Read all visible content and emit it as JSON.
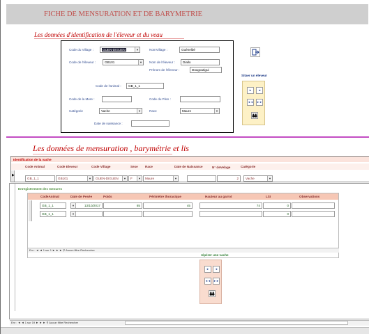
{
  "header": {
    "title": "FICHE DE MENSURATION ET DE BARYMETRIE"
  },
  "section_eleveur": {
    "heading": "Les données d'identification de l'éleveur et du veau",
    "code_village_label": "Code du Village :",
    "code_village_value": "GUEN-DIGUEN",
    "nom_village_label": "NomVillage :",
    "nom_village_value": "Guénelbé",
    "code_eleveur_label": "Code de l'éleveur :",
    "code_eleveur_value": "GB101",
    "nom_eleveur_label": "Nom de l'éleveur :",
    "nom_eleveur_value": "Diallo",
    "prenom_eleveur_label": "Prénom de l'éleveur :",
    "prenom_eleveur_value": "Dougoutigui",
    "code_animal_label": "Code de l'animal :",
    "code_animal_value": "GB_1_1",
    "code_mere_label": "Code de la Mere :",
    "code_pere_label": "Code du Père :",
    "categorie_label": "Catégorie",
    "categorie_value": "Vache",
    "race_label": "Race",
    "race_value": "Maure",
    "date_naissance_label": "Date de naissance :",
    "siter_title": "Sitaer un éleveur"
  },
  "section_mensuration": {
    "heading": "Les données de mensuration , barymétrie et lis",
    "identification_label": "Identification de la vache",
    "columns": [
      "Code Animal",
      "Code Eleveur",
      "Code Village",
      "Sexe",
      "Race",
      "Date de Naissance",
      "N° deVelage",
      "Catégorie"
    ],
    "row": {
      "code_animal": "GB_1_1",
      "code_eleveur": "GB101",
      "code_village": "GUEN-DIGUEN",
      "sexe": "F",
      "race": "Maure",
      "date_naissance": "",
      "velage": "2",
      "categorie": "Vache"
    }
  },
  "mesures": {
    "label": "Enregistrement des mesures",
    "columns": [
      "CodeAnimal",
      "Date de Pesée",
      "Poids",
      "Périmètre thoracique",
      "Hauteur au garrot",
      "LSI",
      "Observations"
    ],
    "rows": [
      {
        "code": "GB_1_1",
        "date": "13/10/2017",
        "poids": "85",
        "perimetre": "45",
        "hauteur": "74",
        "lsi": "0",
        "obs": ""
      },
      {
        "code": "GB_1_1",
        "date": "",
        "poids": "",
        "perimetre": "",
        "hauteur": "",
        "lsi": "0",
        "obs": ""
      }
    ],
    "nav_text": "Enr : ◄ ◄ 1 sur 1 ► ► ►  ⚲ Aucun filtre  Rechercher",
    "repere_title": "répérer une vache"
  },
  "footer": {
    "nav_text": "Enr : ◄ ◄ 1 sur 19 ► ► ►  ⚲ Aucun filtre  Rechercher"
  },
  "icons": {
    "exit": "exit-door-icon",
    "binoculars": "binoculars-icon"
  },
  "colors": {
    "title": "#c0504d",
    "section": "#c00000",
    "separator": "#c34cc3",
    "label": "#2f4a8f",
    "green_label": "#4f8f3f"
  }
}
